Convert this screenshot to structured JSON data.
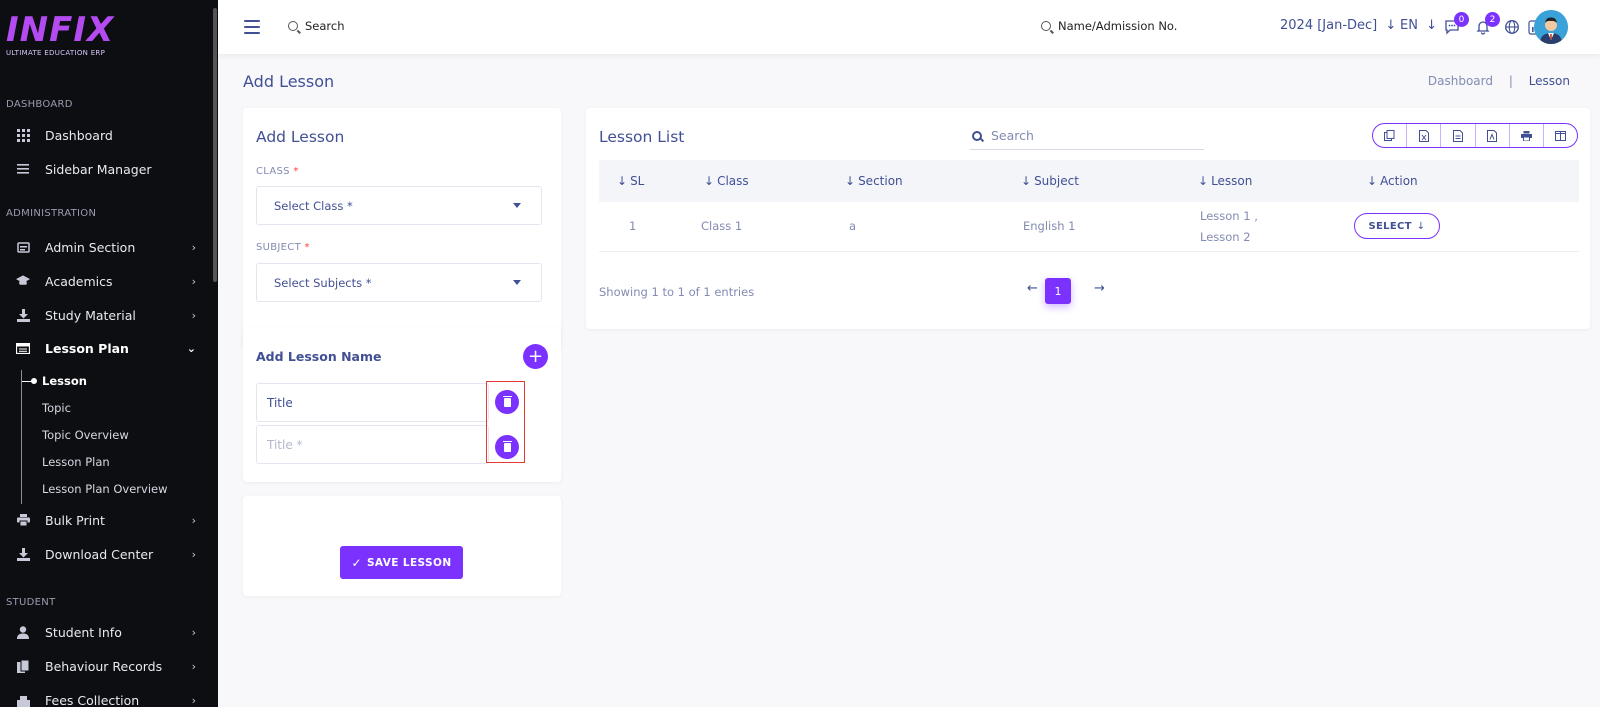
{
  "sidebar": {
    "logo": {
      "text": "INFIX",
      "subtitle": "ULTIMATE EDUCATION ERP"
    },
    "sections": {
      "dashboard": "DASHBOARD",
      "administration": "ADMINISTRATION",
      "student": "STUDENT"
    },
    "items": {
      "dashboard": "Dashboard",
      "sidebar_manager": "Sidebar Manager",
      "admin_section": "Admin Section",
      "academics": "Academics",
      "study_material": "Study Material",
      "lesson_plan": "Lesson Plan",
      "bulk_print": "Bulk Print",
      "download_center": "Download Center",
      "student_info": "Student Info",
      "behaviour_records": "Behaviour Records",
      "fees_collection": "Fees Collection"
    },
    "lesson_plan_sub": {
      "lesson": "Lesson",
      "topic": "Topic",
      "topic_overview": "Topic Overview",
      "lesson_plan": "Lesson Plan",
      "lesson_plan_overview": "Lesson Plan Overview"
    }
  },
  "header": {
    "search_label": "Search",
    "student_search_label": "Name/Admission No.",
    "academic_year": "2024 [Jan-Dec]",
    "language": "EN",
    "messages_count": "0",
    "notifications_count": "2"
  },
  "page": {
    "title": "Add Lesson",
    "breadcrumb": {
      "home": "Dashboard",
      "separator": "|",
      "current": "Lesson"
    }
  },
  "add_lesson_form": {
    "title": "Add Lesson",
    "class_label": "CLASS",
    "required_mark": "*",
    "class_placeholder": "Select Class *",
    "subject_label": "SUBJECT",
    "subject_placeholder": "Select Subjects *"
  },
  "lesson_names": {
    "title": "Add Lesson Name",
    "plus": "+",
    "rows": [
      {
        "value": "Title"
      },
      {
        "placeholder": "Title *"
      }
    ]
  },
  "save": {
    "label": "SAVE LESSON",
    "check": "✓"
  },
  "lesson_list": {
    "title": "Lesson List",
    "search_placeholder": "Search",
    "columns": {
      "sl": "SL",
      "class": "Class",
      "section": "Section",
      "subject": "Subject",
      "lesson": "Lesson",
      "action": "Action"
    },
    "rows": [
      {
        "sl": "1",
        "class": "Class 1",
        "section": "a",
        "subject": "English 1",
        "lesson_line1": "Lesson 1 ,",
        "lesson_line2": "Lesson 2",
        "action": "SELECT"
      }
    ],
    "showing": "Showing 1 to 1 of 1 entries",
    "pagination": {
      "prev": "←",
      "current": "1",
      "next": "→"
    }
  },
  "colors": {
    "accent": "#7c32ff",
    "primary_text": "#415094",
    "muted_text": "#828bb2",
    "sidebar_bg": "#0d0e12",
    "highlight": "#e53935"
  }
}
